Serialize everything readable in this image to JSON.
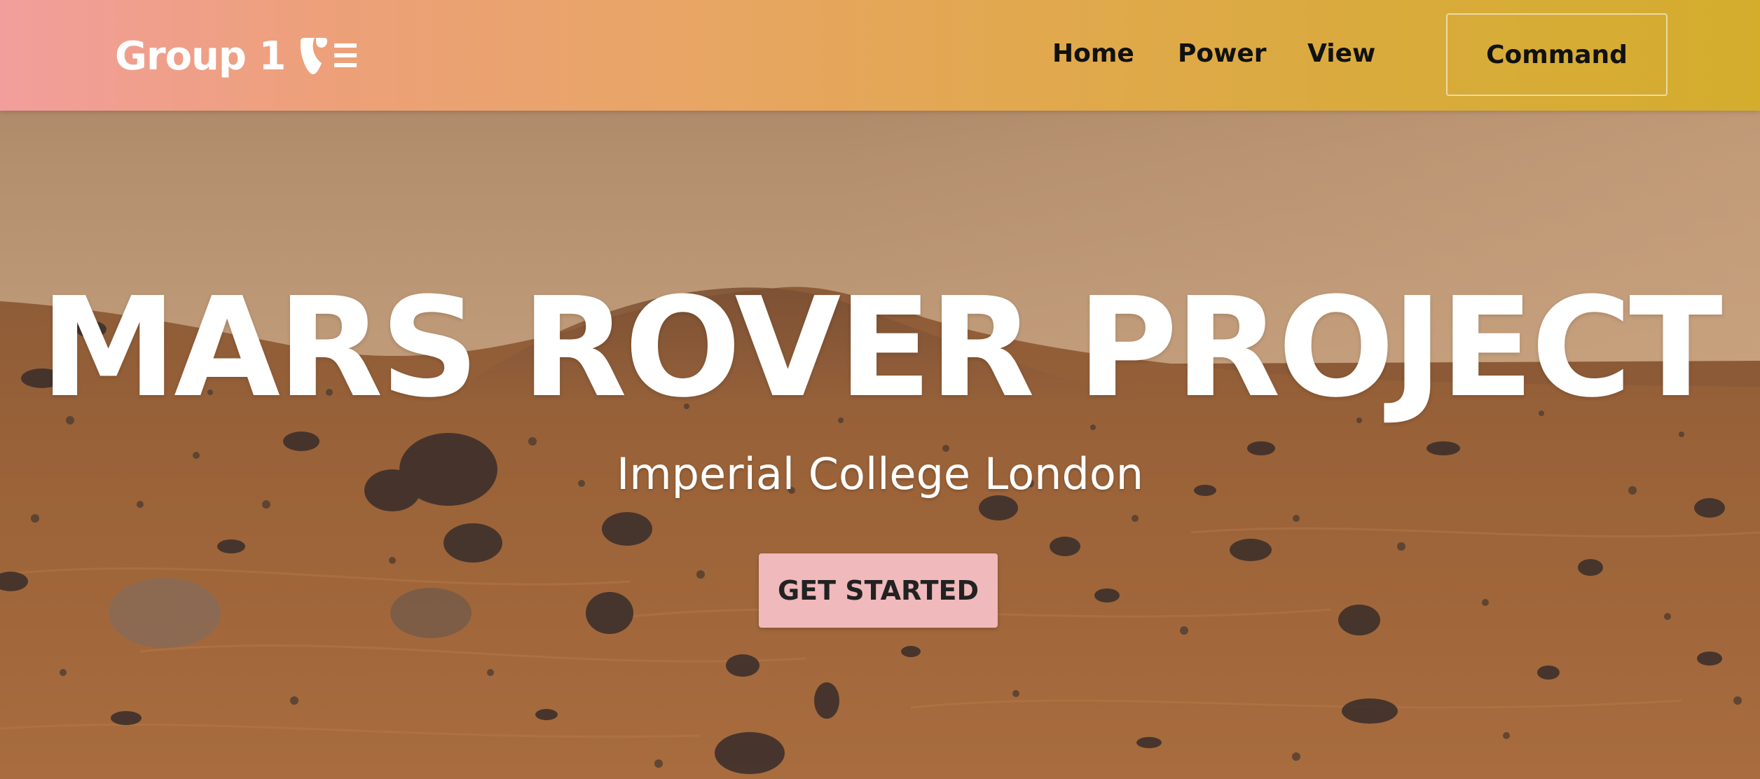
{
  "navbar": {
    "brand": "Group 1",
    "brand_logo_icon": "typo3-logo-icon",
    "links": {
      "home": "Home",
      "power": "Power",
      "view": "View"
    },
    "command_button": "Command"
  },
  "hero": {
    "title": "MARS ROVER PROJECT",
    "subtitle": "Imperial College London",
    "cta_label": "GET STARTED",
    "background_image": "mars-landscape"
  },
  "colors": {
    "navbar_gradient_start": "#f29e9c",
    "navbar_gradient_end": "#d4ad2d",
    "cta_background": "#f0b9bc",
    "hero_text": "#ffffff",
    "nav_text": "#111111"
  }
}
